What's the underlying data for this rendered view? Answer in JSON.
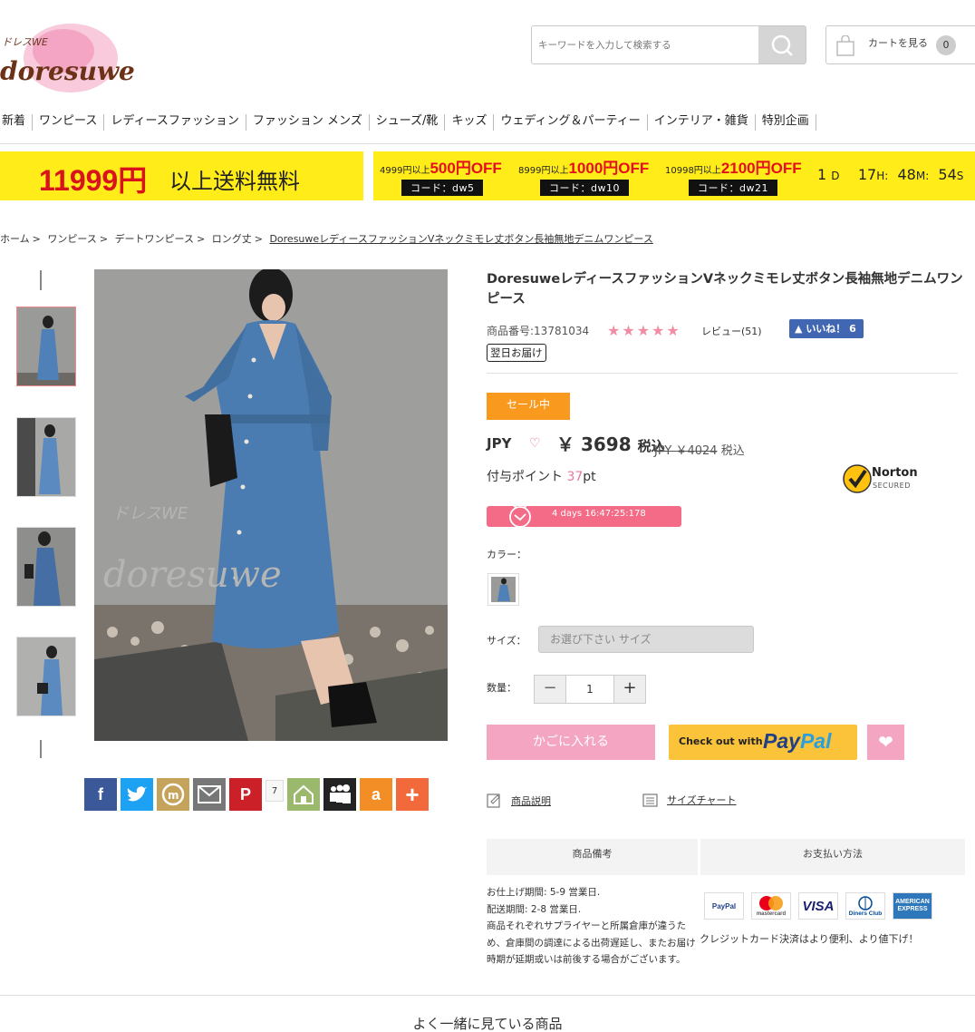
{
  "brand": {
    "logo_text": "doresuwe",
    "logo_kana": "ドレスWE"
  },
  "search": {
    "placeholder": "キーワードを入力して検索する"
  },
  "cart": {
    "label": "カートを見る",
    "count": "0"
  },
  "nav": [
    "新着",
    "ワンピース",
    "レディースファッション",
    "ファッション メンズ",
    "シューズ/靴",
    "キッズ",
    "ウェディング＆パーティー",
    "インテリア・雑貨",
    "特別企画"
  ],
  "banner": {
    "free_shipping_amount": "11999円",
    "free_shipping_text": "以上送料無料",
    "coupons": [
      {
        "threshold": "4999円以上",
        "discount": "500円OFF",
        "code": "コード：dw5"
      },
      {
        "threshold": "8999円以上",
        "discount": "1000円OFF",
        "code": "コード：dw10"
      },
      {
        "threshold": "10998円以上",
        "discount": "2100円OFF",
        "code": "コード：dw21"
      }
    ],
    "countdown": {
      "days": "1",
      "d": "D",
      "hours": "17",
      "h": "H:",
      "minutes": "48",
      "m": "M:",
      "seconds": "54",
      "s": "S"
    }
  },
  "breadcrumb": [
    "ホーム",
    "ワンピース",
    "デートワンピース",
    "ロング丈",
    "DoresuweレディースファッションVネックミモレ丈ボタン長袖無地デニムワンピース"
  ],
  "product": {
    "title": "DoresuweレディースファッションVネックミモレ丈ボタン長袖無地デニムワンピース",
    "sku": "商品番号:13781034",
    "stars": "★★★★★",
    "review": "レビュー(51)",
    "fb_like": "いいね！ 6",
    "delivery_tag": "翌日お届け",
    "sale_badge": "セール中",
    "currency": "JPY",
    "price": "￥ 3698",
    "tax_label": "税込",
    "old_price_prefix": "JPY ￥4024",
    "old_price_tax": "税込",
    "points_label": "付与ポイント",
    "points_value": "37",
    "points_unit": "pt",
    "timer": "4 days 16:47:25:178",
    "color_label": "カラー：",
    "size_label": "サイズ：",
    "size_placeholder": "お選び下さい サイズ",
    "qty_label": "数量：",
    "qty_value": "1",
    "add_to_cart": "かごに入れる",
    "paypal_prefix": "Check out with",
    "paypal_pay": "Pay",
    "paypal_pal": "Pal",
    "norton": "Norton",
    "norton_sub": "SECURED"
  },
  "links": {
    "description": "商品説明",
    "size_chart": "サイズチャート"
  },
  "tabs": {
    "notes": "商品備考",
    "payment": "お支払い方法"
  },
  "notes": {
    "line1": "お仕上げ期間: 5-9 営業日.",
    "line2": "配送期間: 2-8 営業日.",
    "line3": "商品それぞれサプライヤーと所属倉庫が違うため、倉庫間の調達による出荷遅延し、またお届け時期が延期或いは前後する場合がございます。"
  },
  "payment": {
    "cards": [
      "PayPal",
      "mastercard",
      "VISA",
      "Diners Club",
      "AMERICAN EXPRESS"
    ],
    "note": "クレジットカード決済はより便利、より値下げ！"
  },
  "share": {
    "count": "7"
  },
  "together": "よく一緒に見ている商品",
  "colors": {
    "accent_pink": "#f3a5c1",
    "sale_orange": "#f99a1e",
    "banner_yellow": "#ffec18",
    "price_red": "#e4101b"
  }
}
